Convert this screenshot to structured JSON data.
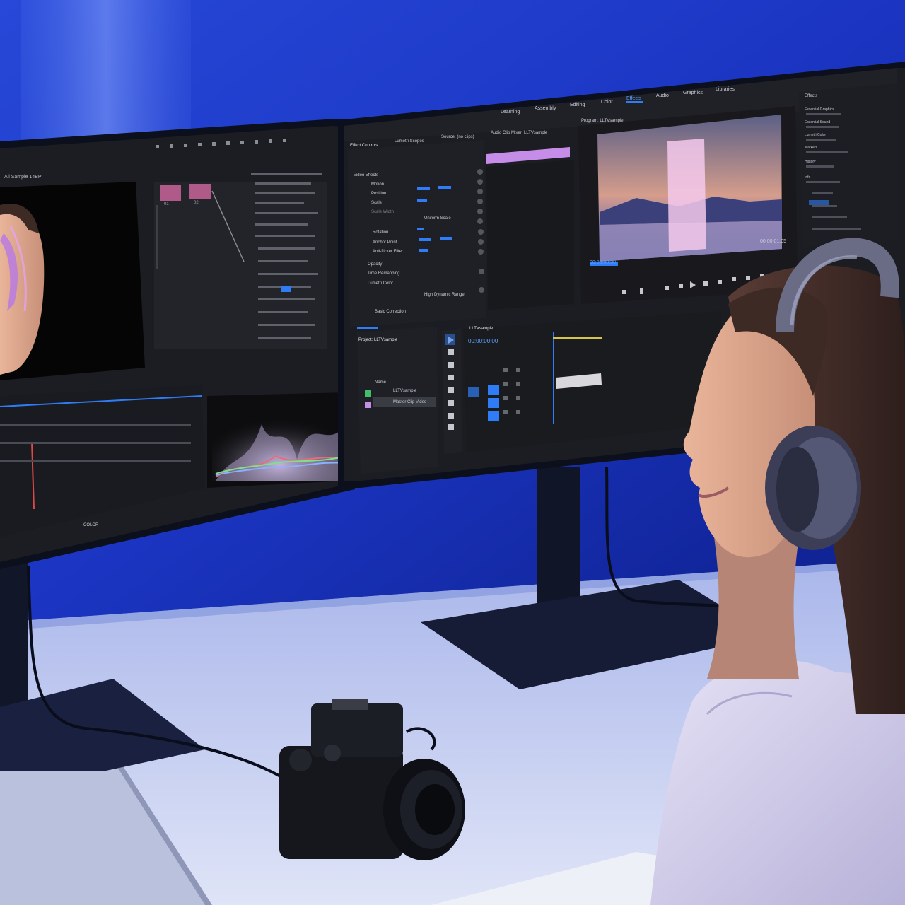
{
  "scene": {
    "description_free": true,
    "colors": {
      "wall": "#1f3fd1",
      "wall_glow": "#6f8ff0",
      "desk": "#c9d2f2",
      "monitor_body": "#141a33",
      "screen_bg": "#1c1d22",
      "accent_blue": "#2f7df6",
      "timeline_pink": "#c68de8"
    }
  },
  "left_app": {
    "viewer_title": "All Sample 14BP",
    "node_labels": [
      "01",
      "02"
    ],
    "footer_label": "COLOR"
  },
  "right_app": {
    "workspaces": [
      "Learning",
      "Assembly",
      "Editing",
      "Color",
      "Effects",
      "Audio",
      "Graphics",
      "Libraries"
    ],
    "active_workspace": "Effects",
    "panel_tabs": [
      "Effect Controls",
      "Lumetri Scopes",
      "Source: (no clips)",
      "Audio Clip Mixer: LLTVsample"
    ],
    "program_title": "Program: LLTVsample",
    "effect_rows": [
      "Video Effects",
      "Motion",
      "Position",
      "Scale",
      "Scale Width",
      "Uniform Scale",
      "Rotation",
      "Anchor Point",
      "Anti-flicker Filter",
      "Opacity",
      "Time Remapping",
      "Lumetri Color",
      "High Dynamic Range",
      "Basic Correction"
    ],
    "program_timecode": "00:00:00:00",
    "program_duration": "00:00:01:05",
    "project_title": "Project: LLTVsample",
    "project_items": [
      "Name",
      "LLTVsample",
      "Master Clip Video"
    ],
    "timeline_title": "LLTVsample",
    "timeline_timecode": "00:00:00:00",
    "effects_panel_title": "Effects",
    "effects_items": [
      "Essential Graphics",
      "Essential Sound",
      "Lumetri Color",
      "Markers",
      "History",
      "Info"
    ]
  }
}
